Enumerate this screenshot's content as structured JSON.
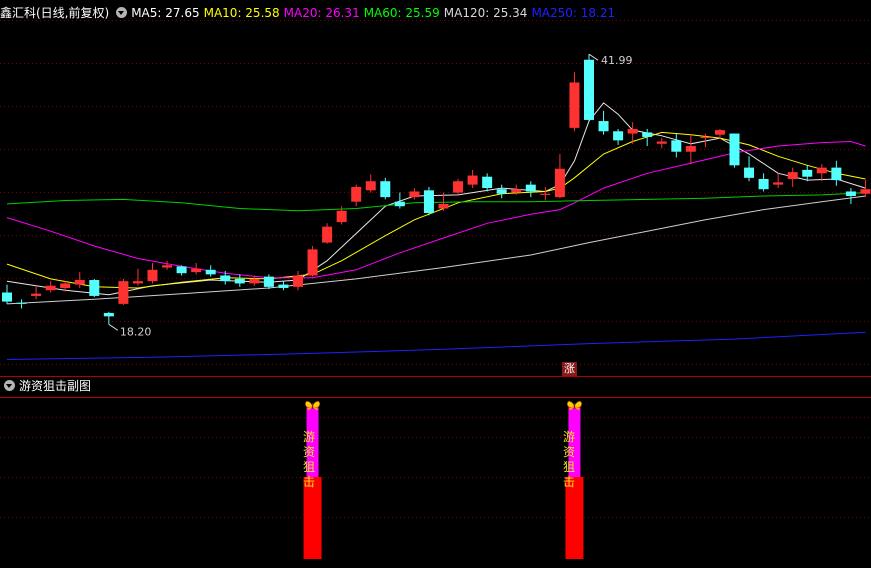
{
  "header": {
    "title": "鑫汇科(日线,前复权)",
    "ma": [
      {
        "label": "MA5: 27.65",
        "color": "#ffffff"
      },
      {
        "label": "MA10: 25.58",
        "color": "#ffff00"
      },
      {
        "label": "MA20: 26.31",
        "color": "#ff00ff"
      },
      {
        "label": "MA60: 25.59",
        "color": "#00ff00"
      },
      {
        "label": "MA120: 25.34",
        "color": "#d8d8d8"
      },
      {
        "label": "MA250: 18.21",
        "color": "#2020ff"
      }
    ]
  },
  "sub": {
    "title": "游资狙击副图",
    "signal_text": "游资狙击",
    "icon": "butterfly-icon"
  },
  "annotations": {
    "high": "41.99",
    "low": "18.20",
    "limit_up_tag": "涨"
  },
  "colors": {
    "up": "#ff3232",
    "down": "#54ffff",
    "grid": "#7a0000"
  },
  "chart_data": {
    "type": "candlestick",
    "ylim": [
      14,
      45
    ],
    "candles": [
      [
        21.0,
        20.2,
        21.7,
        20.0
      ],
      [
        20.1,
        20.0,
        20.4,
        19.6
      ],
      [
        20.7,
        20.9,
        21.6,
        20.4
      ],
      [
        21.2,
        21.6,
        22.0,
        21.0
      ],
      [
        21.4,
        21.8,
        22.0,
        21.1
      ],
      [
        21.7,
        22.1,
        22.8,
        21.4
      ],
      [
        22.1,
        20.7,
        22.2,
        20.6
      ],
      [
        19.2,
        18.9,
        19.3,
        18.2
      ],
      [
        20.0,
        22.0,
        22.2,
        19.9
      ],
      [
        21.8,
        22.0,
        23.1,
        21.6
      ],
      [
        22.0,
        23.0,
        23.6,
        21.8
      ],
      [
        23.2,
        23.4,
        23.8,
        23.0
      ],
      [
        23.3,
        22.7,
        23.4,
        22.5
      ],
      [
        22.8,
        23.1,
        23.6,
        22.6
      ],
      [
        23.0,
        22.6,
        23.4,
        22.4
      ],
      [
        22.5,
        22.0,
        22.9,
        21.7
      ],
      [
        22.2,
        21.8,
        22.6,
        21.5
      ],
      [
        21.8,
        22.2,
        22.5,
        21.6
      ],
      [
        22.4,
        21.5,
        22.6,
        21.3
      ],
      [
        21.7,
        21.4,
        22.0,
        21.2
      ],
      [
        21.5,
        22.5,
        22.9,
        21.2
      ],
      [
        22.5,
        24.8,
        25.1,
        22.4
      ],
      [
        25.4,
        26.8,
        27.1,
        25.3
      ],
      [
        27.2,
        28.2,
        28.6,
        27.0
      ],
      [
        29.0,
        30.3,
        30.5,
        28.6
      ],
      [
        30.0,
        30.8,
        31.4,
        29.8
      ],
      [
        30.8,
        29.4,
        31.1,
        29.2
      ],
      [
        29.0,
        28.6,
        29.8,
        28.4
      ],
      [
        29.4,
        29.9,
        30.2,
        29.2
      ],
      [
        30.0,
        28.0,
        30.3,
        27.8
      ],
      [
        28.4,
        28.8,
        29.8,
        28.2
      ],
      [
        29.8,
        30.8,
        31.0,
        29.6
      ],
      [
        30.5,
        31.3,
        31.8,
        30.2
      ],
      [
        31.2,
        30.2,
        31.5,
        29.9
      ],
      [
        30.1,
        29.7,
        30.5,
        29.3
      ],
      [
        29.8,
        30.1,
        30.5,
        29.6
      ],
      [
        30.5,
        29.9,
        30.8,
        29.4
      ],
      [
        29.6,
        29.7,
        30.3,
        29.1
      ],
      [
        29.4,
        31.9,
        33.2,
        29.3
      ],
      [
        35.5,
        39.5,
        40.4,
        35.2
      ],
      [
        41.5,
        36.2,
        41.99,
        36.1
      ],
      [
        36.1,
        35.2,
        37.0,
        34.9
      ],
      [
        35.2,
        34.4,
        35.4,
        34.0
      ],
      [
        35.0,
        35.4,
        36.0,
        34.1
      ],
      [
        35.1,
        34.7,
        35.4,
        33.9
      ],
      [
        34.1,
        34.3,
        34.6,
        33.7
      ],
      [
        34.4,
        33.4,
        35.0,
        32.9
      ],
      [
        33.4,
        33.9,
        34.9,
        32.3
      ],
      [
        34.6,
        34.7,
        35.0,
        33.8
      ],
      [
        34.9,
        35.3,
        35.4,
        34.5
      ],
      [
        35.0,
        32.2,
        35.0,
        32.0
      ],
      [
        32.0,
        31.1,
        33.0,
        30.8
      ],
      [
        31.0,
        30.1,
        31.5,
        29.9
      ],
      [
        30.5,
        30.7,
        31.5,
        30.2
      ],
      [
        31.0,
        31.6,
        32.0,
        30.3
      ],
      [
        31.8,
        31.2,
        32.2,
        30.8
      ],
      [
        31.5,
        32.0,
        32.3,
        30.8
      ],
      [
        32.0,
        30.9,
        32.6,
        30.4
      ],
      [
        29.9,
        29.5,
        30.2,
        28.8
      ],
      [
        29.7,
        30.1,
        30.9,
        29.4
      ]
    ],
    "signals": [
      21,
      39
    ],
    "ma": {
      "MA5": [
        [
          0,
          22.0
        ],
        [
          4,
          21.2
        ],
        [
          7,
          20.8
        ],
        [
          10,
          21.6
        ],
        [
          14,
          22.1
        ],
        [
          18,
          21.9
        ],
        [
          20,
          22.1
        ],
        [
          22,
          23.8
        ],
        [
          24,
          26.2
        ],
        [
          26,
          28.6
        ],
        [
          28,
          29.5
        ],
        [
          31,
          29.6
        ],
        [
          34,
          30.2
        ],
        [
          37,
          29.9
        ],
        [
          38,
          30.5
        ],
        [
          39,
          32.6
        ],
        [
          40,
          36.1
        ],
        [
          41,
          37.7
        ],
        [
          42,
          36.7
        ],
        [
          43,
          35.3
        ],
        [
          45,
          34.8
        ],
        [
          47,
          34.1
        ],
        [
          49,
          34.6
        ],
        [
          51,
          33.2
        ],
        [
          53,
          31.5
        ],
        [
          55,
          30.9
        ],
        [
          57,
          31.0
        ],
        [
          59,
          30.2
        ]
      ],
      "MA10": [
        [
          0,
          23.5
        ],
        [
          3,
          22.2
        ],
        [
          6,
          21.5
        ],
        [
          9,
          21.4
        ],
        [
          12,
          21.9
        ],
        [
          15,
          22.3
        ],
        [
          18,
          22.2
        ],
        [
          21,
          22.6
        ],
        [
          23,
          23.8
        ],
        [
          26,
          26.0
        ],
        [
          28,
          27.4
        ],
        [
          31,
          28.9
        ],
        [
          34,
          29.7
        ],
        [
          37,
          29.9
        ],
        [
          38,
          30.2
        ],
        [
          39,
          31.1
        ],
        [
          41,
          33.2
        ],
        [
          43,
          34.3
        ],
        [
          45,
          35.1
        ],
        [
          47,
          34.9
        ],
        [
          49,
          34.6
        ],
        [
          51,
          34.0
        ],
        [
          53,
          33.0
        ],
        [
          55,
          32.2
        ],
        [
          57,
          31.5
        ],
        [
          59,
          31.0
        ]
      ],
      "MA20": [
        [
          0,
          27.6
        ],
        [
          3,
          26.4
        ],
        [
          6,
          25.1
        ],
        [
          9,
          24.0
        ],
        [
          12,
          23.3
        ],
        [
          15,
          22.7
        ],
        [
          18,
          22.3
        ],
        [
          21,
          22.3
        ],
        [
          24,
          23.0
        ],
        [
          27,
          24.5
        ],
        [
          30,
          25.8
        ],
        [
          33,
          27.1
        ],
        [
          36,
          27.9
        ],
        [
          38,
          28.3
        ],
        [
          39,
          28.9
        ],
        [
          41,
          30.2
        ],
        [
          44,
          31.5
        ],
        [
          47,
          32.4
        ],
        [
          50,
          33.3
        ],
        [
          53,
          33.9
        ],
        [
          56,
          34.2
        ],
        [
          58,
          34.3
        ],
        [
          59,
          33.9
        ]
      ],
      "MA60": [
        [
          0,
          28.8
        ],
        [
          4,
          29.1
        ],
        [
          8,
          29.2
        ],
        [
          12,
          28.9
        ],
        [
          16,
          28.4
        ],
        [
          20,
          28.2
        ],
        [
          24,
          28.4
        ],
        [
          28,
          28.9
        ],
        [
          32,
          29.0
        ],
        [
          36,
          29.0
        ],
        [
          40,
          29.1
        ],
        [
          44,
          29.2
        ],
        [
          48,
          29.3
        ],
        [
          52,
          29.5
        ],
        [
          56,
          29.6
        ],
        [
          59,
          29.8
        ]
      ],
      "MA120": [
        [
          0,
          20.0
        ],
        [
          6,
          20.4
        ],
        [
          12,
          20.9
        ],
        [
          18,
          21.4
        ],
        [
          24,
          22.2
        ],
        [
          30,
          23.2
        ],
        [
          36,
          24.3
        ],
        [
          40,
          25.4
        ],
        [
          44,
          26.4
        ],
        [
          48,
          27.4
        ],
        [
          52,
          28.3
        ],
        [
          56,
          29.0
        ],
        [
          59,
          29.5
        ]
      ],
      "MA250": [
        [
          0,
          15.1
        ],
        [
          10,
          15.3
        ],
        [
          20,
          15.6
        ],
        [
          30,
          16.0
        ],
        [
          40,
          16.5
        ],
        [
          50,
          16.9
        ],
        [
          59,
          17.5
        ]
      ]
    }
  }
}
